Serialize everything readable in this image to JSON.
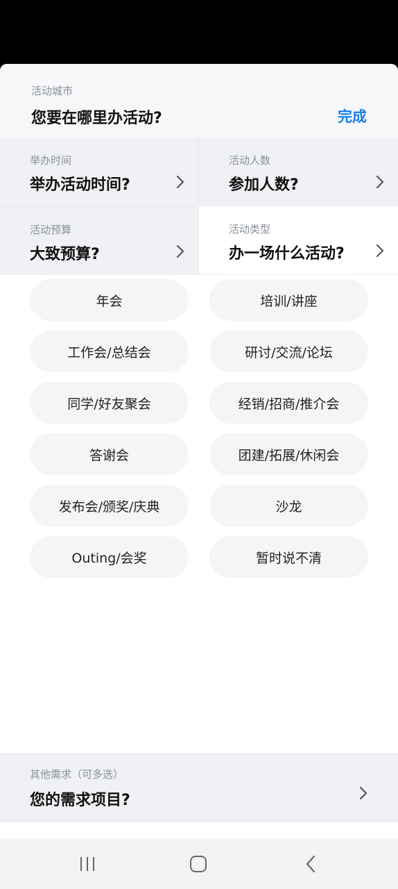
{
  "city": {
    "label": "活动城市",
    "prompt": "您要在哪里办活动?",
    "done_label": "完成"
  },
  "fields": [
    {
      "label": "举办时间",
      "prompt": "举办活动时间?"
    },
    {
      "label": "活动人数",
      "prompt": "参加人数?"
    },
    {
      "label": "活动预算",
      "prompt": "大致预算?"
    },
    {
      "label": "活动类型",
      "prompt": "办一场什么活动?"
    }
  ],
  "event_types": [
    "年会",
    "培训/讲座",
    "工作会/总结会",
    "研讨/交流/论坛",
    "同学/好友聚会",
    "经销/招商/推介会",
    "答谢会",
    "团建/拓展/休闲会",
    "发布会/颁奖/庆典",
    "沙龙",
    "Outing/会奖",
    "暂时说不清"
  ],
  "other": {
    "label": "其他需求（可多选）",
    "prompt": "您的需求项目?"
  },
  "colors": {
    "accent": "#1a7fe0",
    "panel": "#eff1f4",
    "chip": "#f4f5f7"
  },
  "icons": {
    "chevron": "chevron-right-icon",
    "nav_recents": "recents-icon",
    "nav_home": "home-icon",
    "nav_back": "back-icon"
  }
}
